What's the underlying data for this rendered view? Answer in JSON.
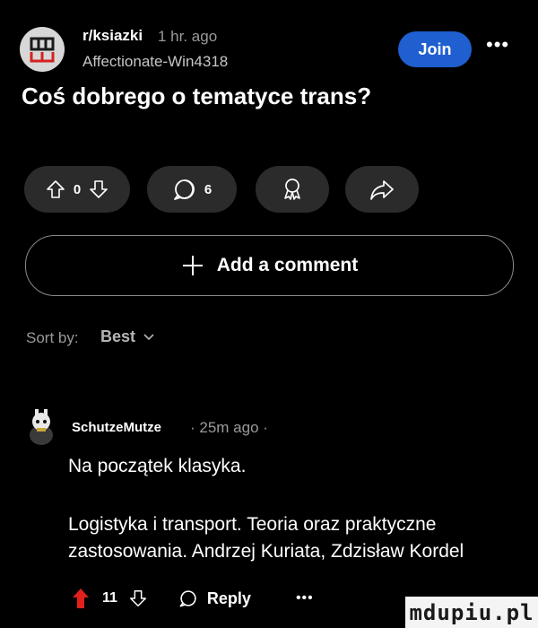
{
  "post": {
    "subreddit": "r/ksiazki",
    "time": "1 hr. ago",
    "author": "Affectionate-Win4318",
    "join_label": "Join",
    "title": "Coś dobrego o tematyce trans?",
    "votes": "0",
    "comments": "6"
  },
  "composer": {
    "label": "Add a comment"
  },
  "sort": {
    "label": "Sort by:",
    "value": "Best"
  },
  "comment": {
    "author": "SchutzeMutze",
    "time": "· 25m ago ·",
    "line1": "Na początek klasyka.",
    "body": "Logistyka i transport. Teoria oraz praktyczne zastosowania. Andrzej Kuriata, Zdzisław Kordel",
    "score": "11",
    "reply_label": "Reply",
    "upvote_color": "#e0201b"
  },
  "watermark": "mdupiu.pl",
  "icons": [
    "sub-logo-icon",
    "more-icon",
    "upvote-icon",
    "downvote-icon",
    "comment-icon",
    "award-icon",
    "share-icon",
    "plus-icon",
    "chevron-down-icon"
  ]
}
